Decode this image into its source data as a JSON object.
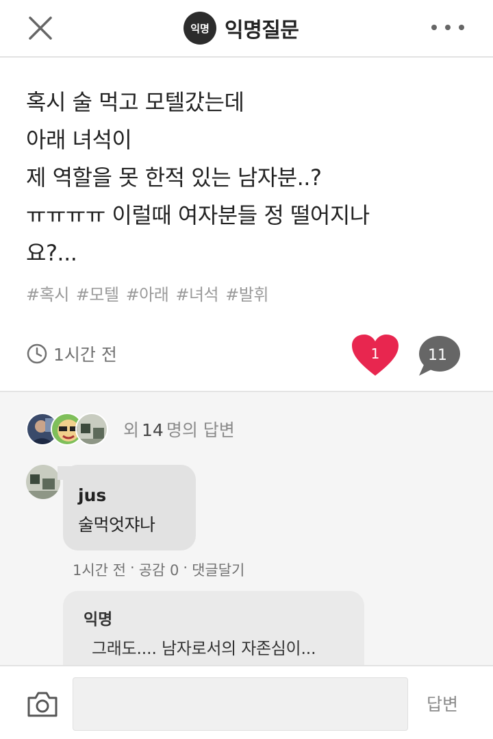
{
  "header": {
    "badge_label": "익명",
    "title": "익명질문"
  },
  "post": {
    "lines": [
      "혹시 술 먹고 모텔갔는데",
      "아래 녀석이",
      "제 역할을 못 한적 있는 남자분..?",
      "ㅠㅠㅠㅠ 이럴때 여자분들 정 떨어지나",
      "요?..."
    ],
    "tags": [
      "#혹시",
      "#모텔",
      "#아래",
      "#녀석",
      "#발휘"
    ],
    "time": "1시간 전",
    "like_count": "1",
    "comment_count": "11"
  },
  "answers": {
    "prefix": "외",
    "count": "14",
    "suffix": "명의 답변"
  },
  "comment": {
    "author": "jus",
    "text": "술먹엇쟈나",
    "time": "1시간 전",
    "sep1": "·",
    "likes": "공감 0",
    "sep2": "·",
    "reply_link": "댓글달기"
  },
  "reply": {
    "author": "익명",
    "text": "그래도.... 남자로서의 자존심이..."
  },
  "bottom": {
    "input_placeholder": "",
    "submit_label": "답변"
  },
  "colors": {
    "heart": "#e8264f",
    "comment_bubble": "#666666",
    "badge": "#2c2c2c",
    "tag_text": "#9a9a9a"
  },
  "icons": {
    "close": "close-icon",
    "more": "more-dots-icon",
    "clock": "clock-icon",
    "heart": "heart-icon",
    "comment": "comment-bubble-icon",
    "camera": "camera-icon"
  }
}
